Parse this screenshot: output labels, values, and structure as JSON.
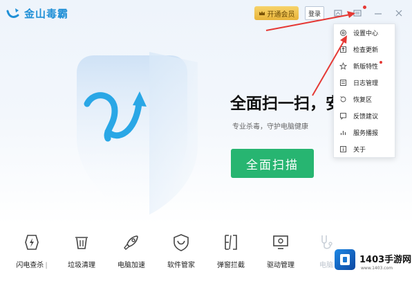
{
  "app": {
    "name": "金山毒霸",
    "vip_label": "开通会员",
    "account_label": "登录"
  },
  "main": {
    "headline": "全面扫一扫，安",
    "subtext": "专业杀毒，守护电脑健康",
    "scan_button": "全面扫描"
  },
  "toolbar": {
    "items": [
      {
        "label": "闪电查杀",
        "icon": "flash-shield-icon"
      },
      {
        "label": "垃圾清理",
        "icon": "trash-icon"
      },
      {
        "label": "电脑加速",
        "icon": "rocket-icon"
      },
      {
        "label": "软件管家",
        "icon": "shield-software-icon"
      },
      {
        "label": "弹窗拦截",
        "icon": "popup-block-icon"
      },
      {
        "label": "驱动管理",
        "icon": "monitor-driver-icon"
      },
      {
        "label": "电脑",
        "icon": "stethoscope-icon"
      }
    ],
    "separator": "|"
  },
  "menu": {
    "items": [
      {
        "label": "设置中心",
        "icon": "gear-icon"
      },
      {
        "label": "检查更新",
        "icon": "update-icon"
      },
      {
        "label": "新版特性",
        "icon": "star-icon"
      },
      {
        "label": "日志管理",
        "icon": "log-icon"
      },
      {
        "label": "恢复区",
        "icon": "restore-icon"
      },
      {
        "label": "反馈建议",
        "icon": "feedback-icon"
      },
      {
        "label": "服务播报",
        "icon": "chart-icon"
      },
      {
        "label": "关于",
        "icon": "info-icon"
      }
    ]
  },
  "watermark": {
    "title": "1403手游网",
    "subtitle": "www.1403.com"
  },
  "colors": {
    "brand_blue": "#1f8fd6",
    "scan_green": "#27b571",
    "vip_gold": "#e8b43a",
    "annotation_red": "#e53935"
  }
}
